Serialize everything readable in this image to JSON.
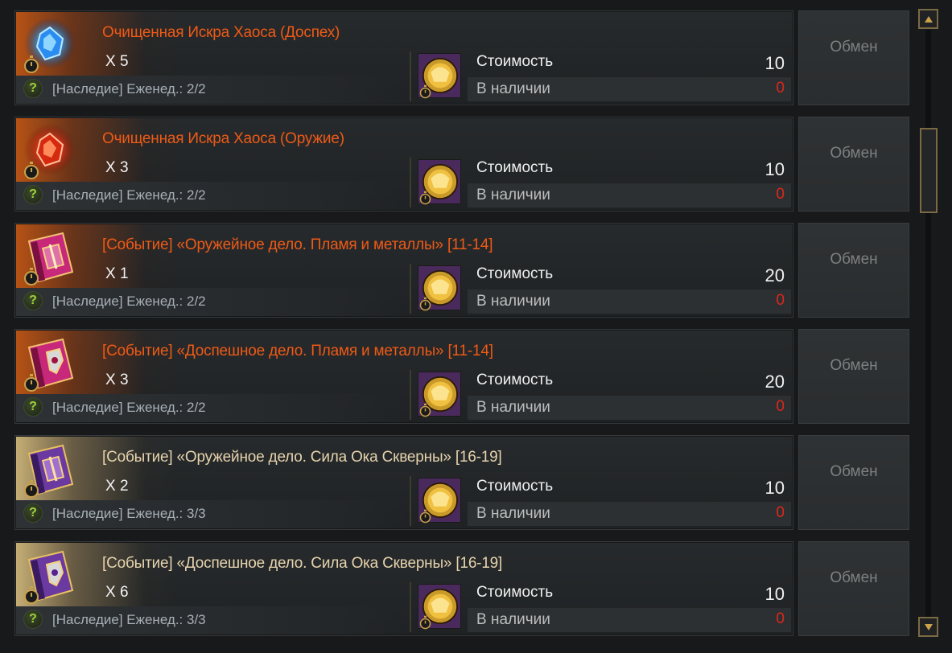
{
  "shop": {
    "items": [
      {
        "name": "Очищенная Искра Хаоса (Доспех)",
        "name_color": "orange",
        "icon": "blue-chaos-spark-icon",
        "quantity": "X 5",
        "limit": "[Наследие] Еженед.: 2/2",
        "cost_label": "Стоимость",
        "cost": "10",
        "stock_label": "В наличии",
        "stock": "0",
        "button": "Обмен"
      },
      {
        "name": "Очищенная Искра Хаоса (Оружие)",
        "name_color": "orange",
        "icon": "red-chaos-spark-icon",
        "quantity": "X 3",
        "limit": "[Наследие] Еженед.: 2/2",
        "cost_label": "Стоимость",
        "cost": "10",
        "stock_label": "В наличии",
        "stock": "0",
        "button": "Обмен"
      },
      {
        "name": "[Событие] «Оружейное дело. Пламя и металлы» [11-14]",
        "name_color": "orange",
        "icon": "pink-weapon-book-icon",
        "quantity": "X 1",
        "limit": "[Наследие] Еженед.: 2/2",
        "cost_label": "Стоимость",
        "cost": "20",
        "stock_label": "В наличии",
        "stock": "0",
        "button": "Обмен"
      },
      {
        "name": "[Событие] «Доспешное дело. Пламя и металлы» [11-14]",
        "name_color": "orange",
        "icon": "pink-armor-book-icon",
        "quantity": "X 3",
        "limit": "[Наследие] Еженед.: 2/2",
        "cost_label": "Стоимость",
        "cost": "20",
        "stock_label": "В наличии",
        "stock": "0",
        "button": "Обмен"
      },
      {
        "name": "[Событие] «Оружейное дело. Сила Ока Скверны» [16-19]",
        "name_color": "cream",
        "icon": "purple-weapon-book-icon",
        "quantity": "X 2",
        "limit": "[Наследие] Еженед.: 3/3",
        "cost_label": "Стоимость",
        "cost": "10",
        "stock_label": "В наличии",
        "stock": "0",
        "button": "Обмен"
      },
      {
        "name": "[Событие] «Доспешное дело. Сила Ока Скверны» [16-19]",
        "name_color": "cream",
        "icon": "purple-armor-book-icon",
        "quantity": "X 6",
        "limit": "[Наследие] Еженед.: 3/3",
        "cost_label": "Стоимость",
        "cost": "10",
        "stock_label": "В наличии",
        "stock": "0",
        "button": "Обмен"
      }
    ],
    "currency_icon": "gold-coin-token-icon",
    "colors": {
      "name_orange": "#ee5a16",
      "name_cream": "#e6d3ad",
      "stock_red": "#e0261a",
      "help_green": "#9fd23a"
    }
  },
  "scrollbar": {
    "up_icon": "scroll-up-icon",
    "down_icon": "scroll-down-icon",
    "position_fraction": 0.2
  }
}
